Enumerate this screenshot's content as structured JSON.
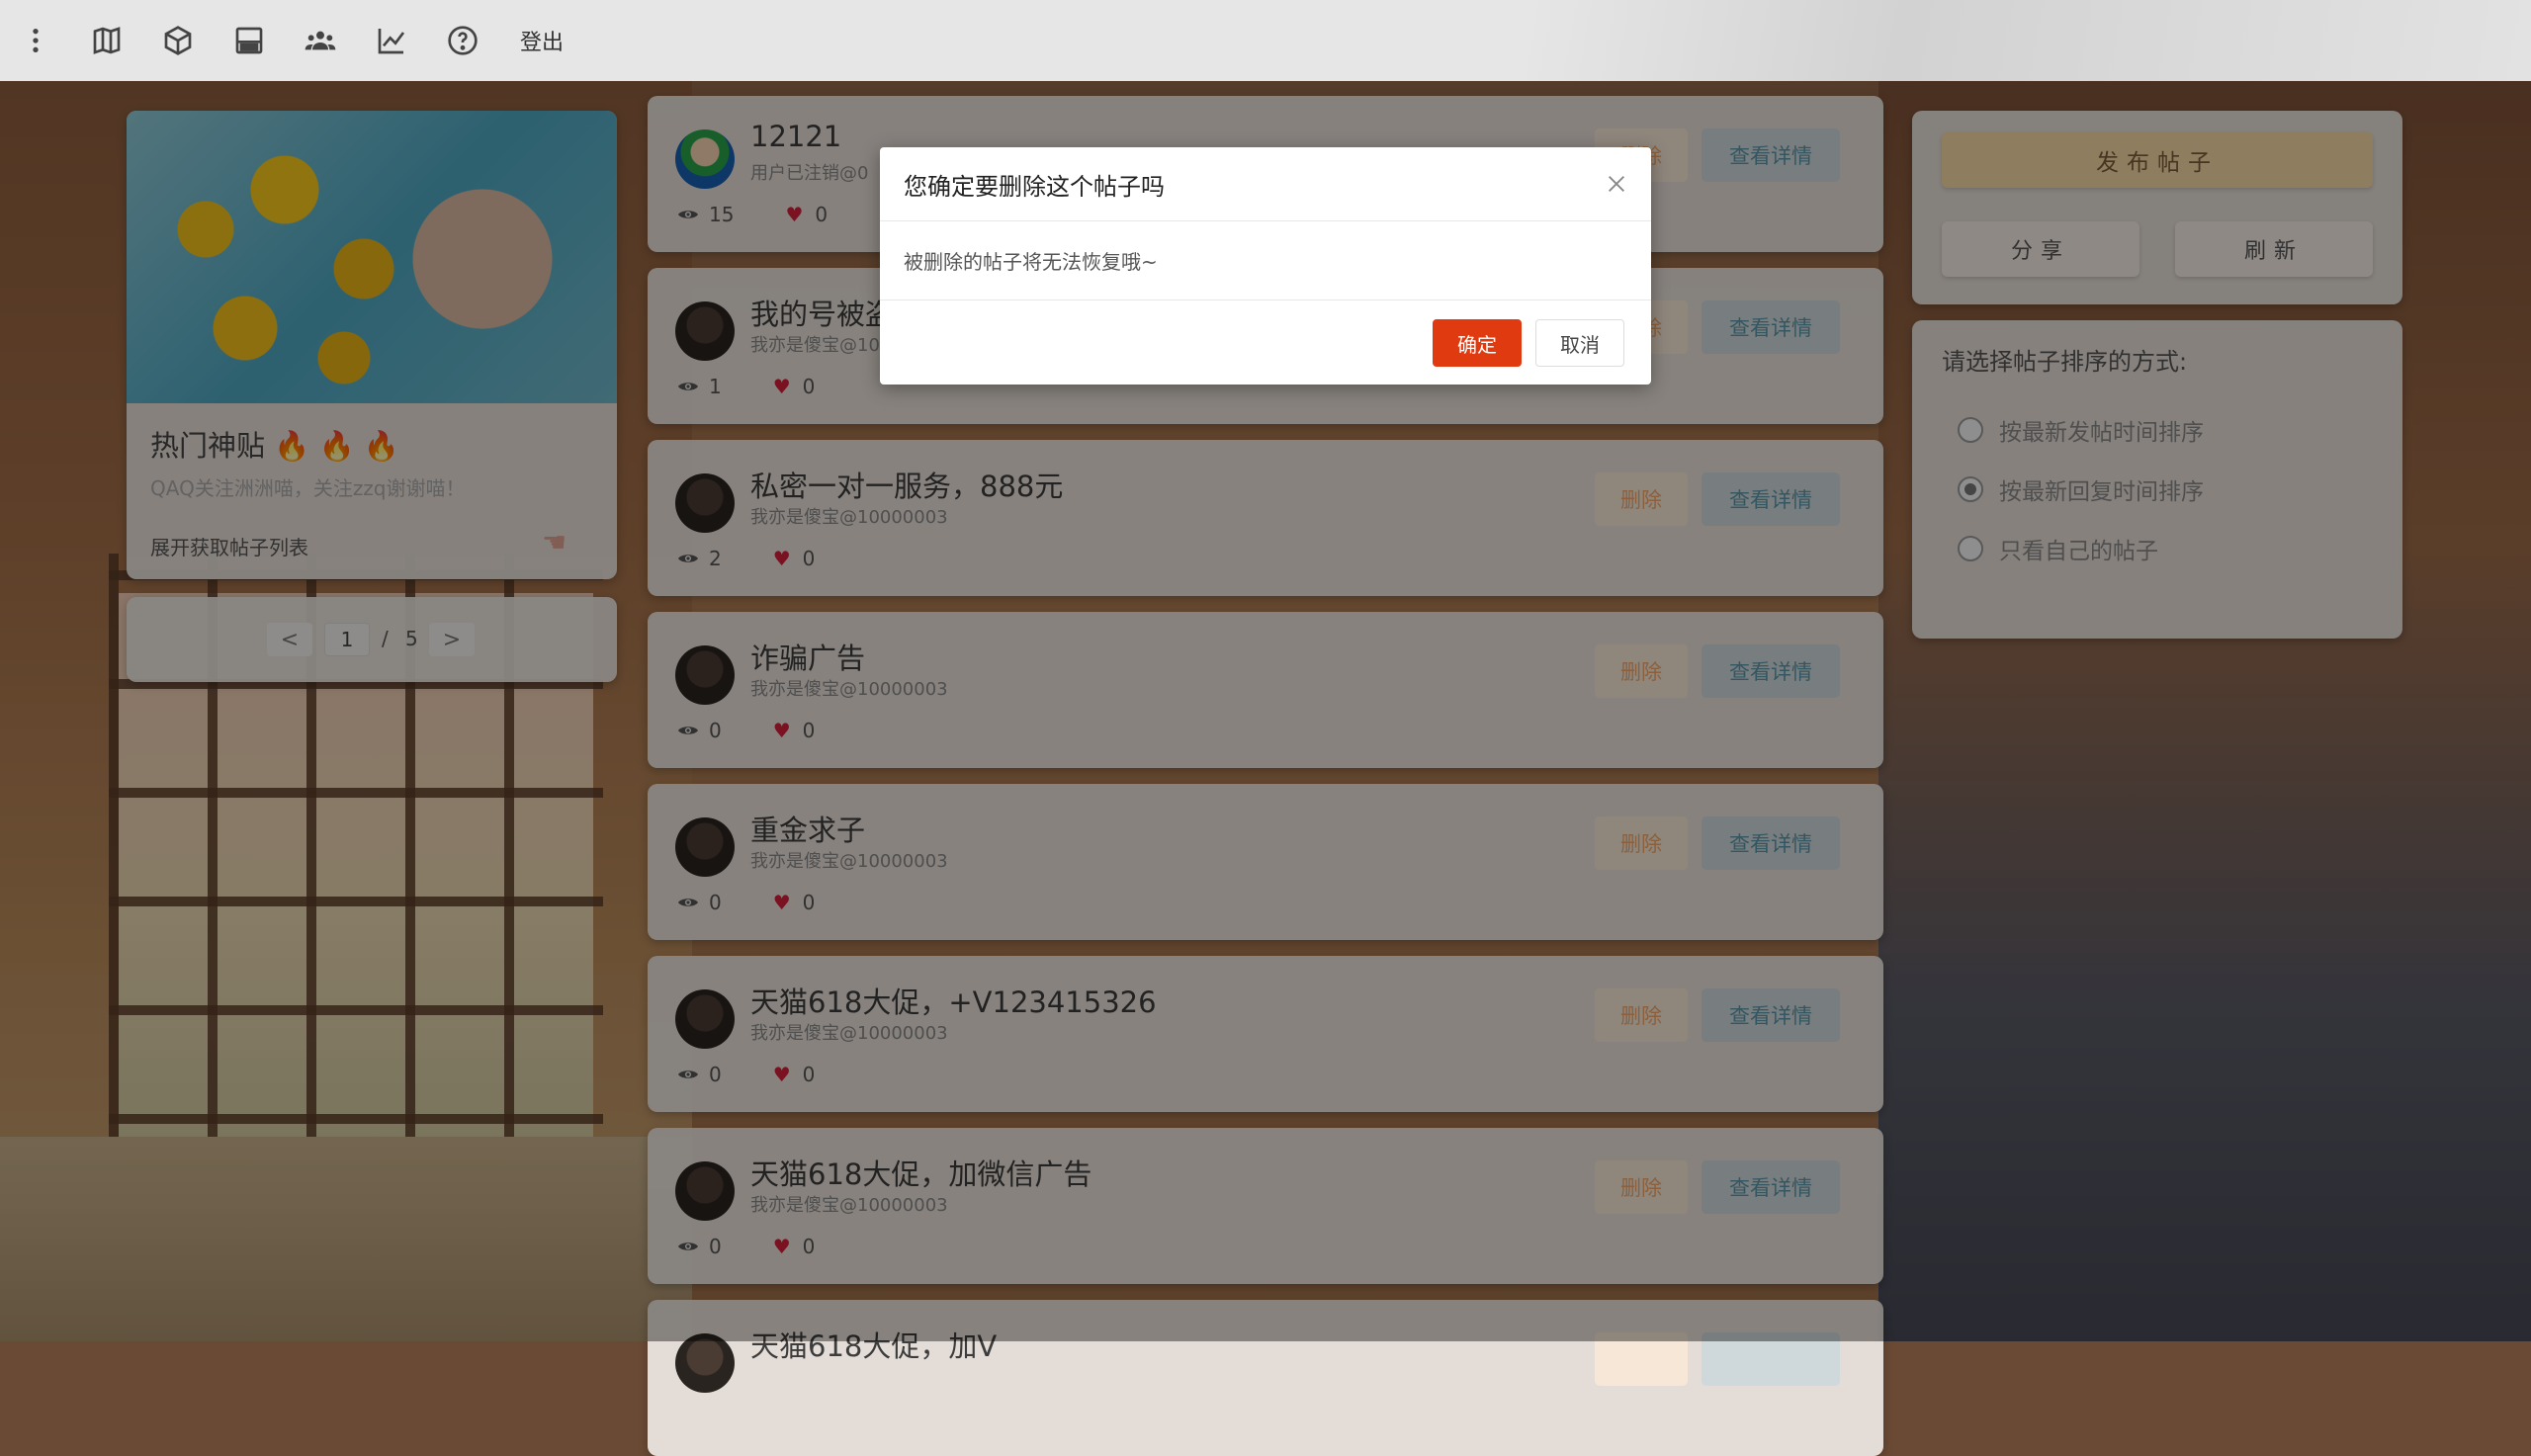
{
  "nav": {
    "icons": [
      "more-vertical-icon",
      "map-icon",
      "cube-icon",
      "storage-icon",
      "group-icon",
      "chart-line-icon",
      "help-icon"
    ],
    "logout_label": "登出"
  },
  "hot": {
    "title": "热门神贴",
    "fire_icons": [
      "🔥",
      "🔥",
      "🔥"
    ],
    "subtitle": "QAQ关注洲洲喵，关注zzq谢谢喵！",
    "expand_label": "展开获取帖子列表"
  },
  "pagination": {
    "prev": "<",
    "next": ">",
    "current": "1",
    "separator": "/",
    "total": "5"
  },
  "posts": [
    {
      "title": "12121",
      "author": "用户已注销@0",
      "views": "15",
      "likes": "0",
      "delete_label": "删除",
      "view_label": "查看详情"
    },
    {
      "title": "我的号被盗",
      "author": "我亦是傻宝@10",
      "views": "1",
      "likes": "0",
      "delete_label": "删除",
      "view_label": "查看详情"
    },
    {
      "title": "私密一对一服务，888元",
      "author": "我亦是傻宝@10000003",
      "views": "2",
      "likes": "0",
      "delete_label": "删除",
      "view_label": "查看详情"
    },
    {
      "title": "诈骗广告",
      "author": "我亦是傻宝@10000003",
      "views": "0",
      "likes": "0",
      "delete_label": "删除",
      "view_label": "查看详情"
    },
    {
      "title": "重金求子",
      "author": "我亦是傻宝@10000003",
      "views": "0",
      "likes": "0",
      "delete_label": "删除",
      "view_label": "查看详情"
    },
    {
      "title": "天猫618大促，+V123415326",
      "author": "我亦是傻宝@10000003",
      "views": "0",
      "likes": "0",
      "delete_label": "删除",
      "view_label": "查看详情"
    },
    {
      "title": "天猫618大促，加微信广告",
      "author": "我亦是傻宝@10000003",
      "views": "0",
      "likes": "0",
      "delete_label": "删除",
      "view_label": "查看详情"
    },
    {
      "title": "天猫618大促，加V",
      "author": "",
      "views": "",
      "likes": "",
      "delete_label": "",
      "view_label": ""
    }
  ],
  "actions": {
    "publish_label": "发布帖子",
    "share_label": "分享",
    "refresh_label": "刷新"
  },
  "sort": {
    "title": "请选择帖子排序的方式:",
    "options": [
      {
        "label": "按最新发帖时间排序",
        "checked": false
      },
      {
        "label": "按最新回复时间排序",
        "checked": true
      },
      {
        "label": "只看自己的帖子",
        "checked": false
      }
    ]
  },
  "dialog": {
    "title": "您确定要删除这个帖子吗",
    "body": "被删除的帖子将无法恢复哦~",
    "ok_label": "确定",
    "cancel_label": "取消"
  },
  "colors": {
    "danger": "#e03a10",
    "publish_bg": "#f7d7a4",
    "heart": "#d2203a"
  }
}
